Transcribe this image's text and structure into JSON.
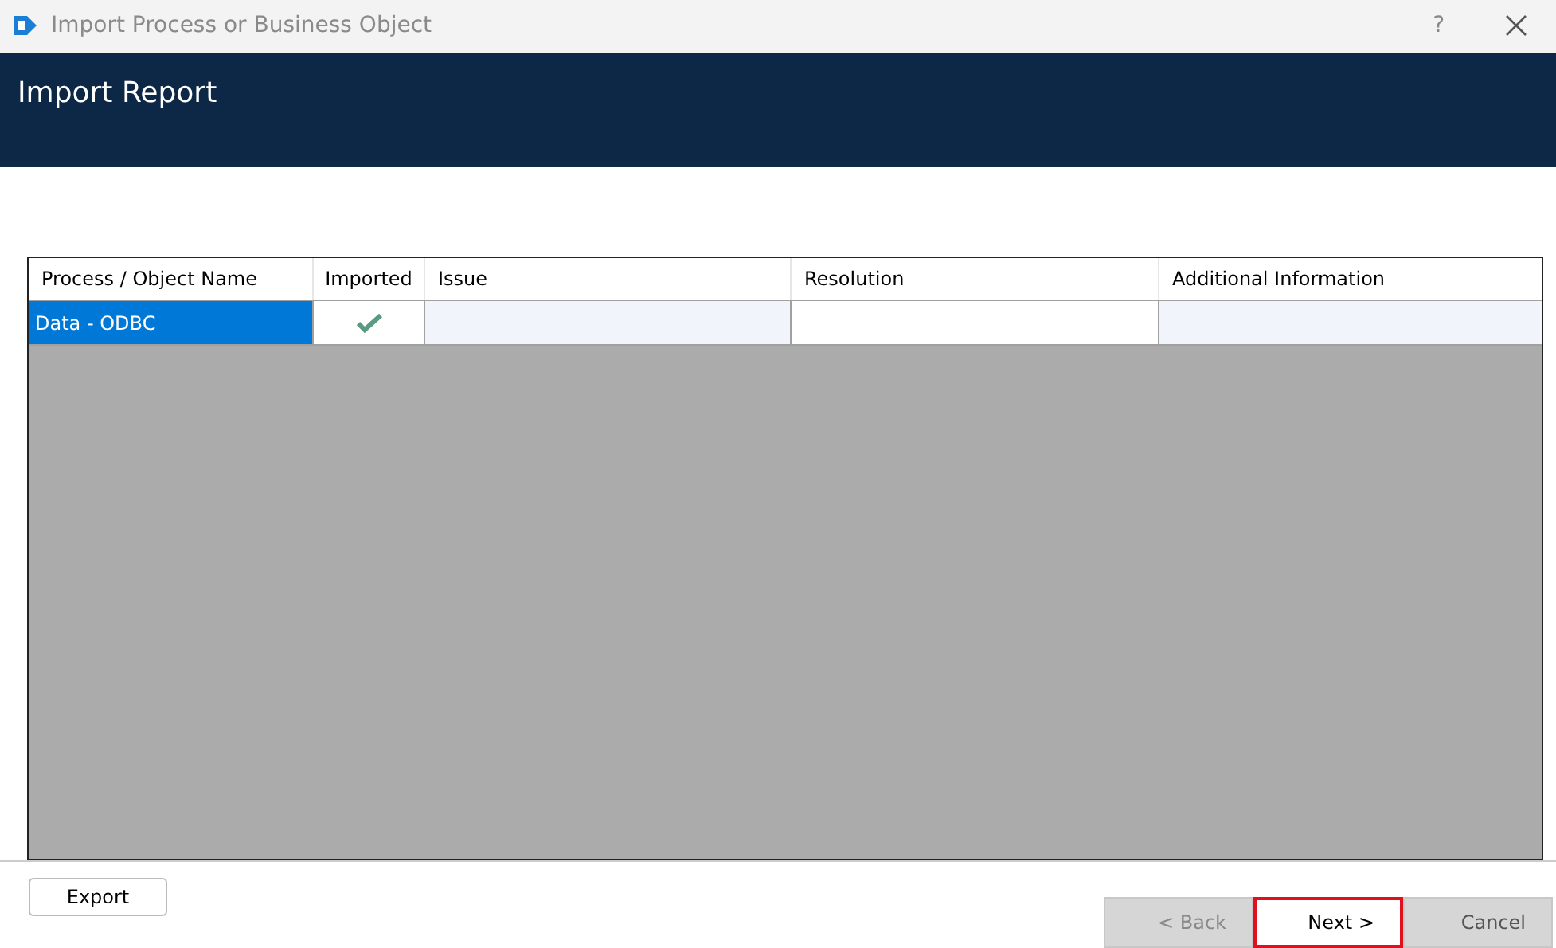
{
  "window": {
    "title": "Import Process or Business Object",
    "help": "?"
  },
  "header": {
    "title": "Import Report"
  },
  "table": {
    "columns": [
      "Process / Object Name",
      "Imported",
      "Issue",
      "Resolution",
      "Additional Information"
    ],
    "rows": [
      {
        "name": "Data - ODBC",
        "imported": true,
        "selected": true
      }
    ]
  },
  "export_button": "Export",
  "buttons": [
    {
      "label": "< Back",
      "disabled": true,
      "highlighted": false
    },
    {
      "label": "Next >",
      "disabled": false,
      "highlighted": true
    },
    {
      "label": "Cancel",
      "disabled": false,
      "highlighted": false
    }
  ]
}
